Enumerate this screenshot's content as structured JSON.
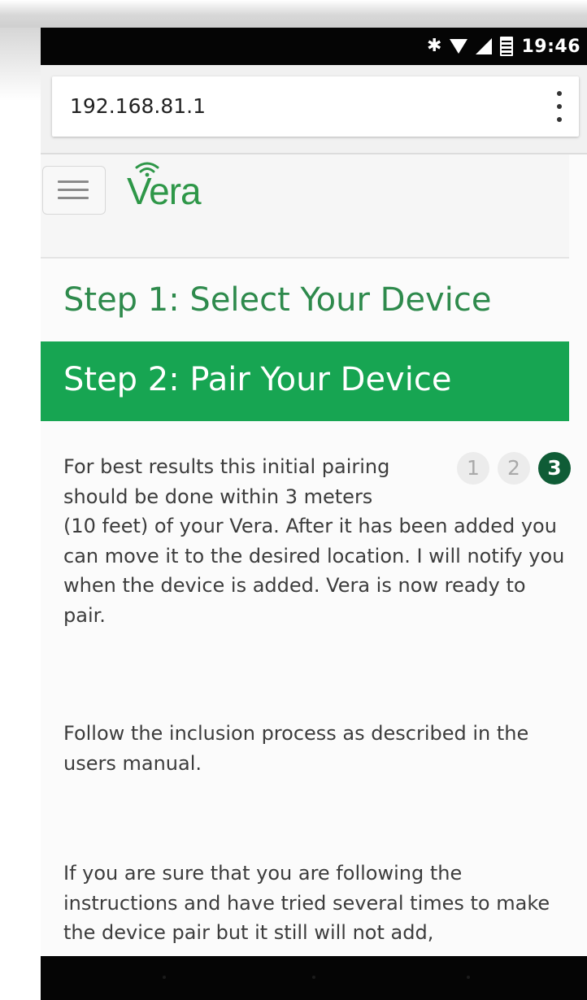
{
  "status_bar": {
    "time": "19:46",
    "icons": [
      "bluetooth-icon",
      "wifi-icon",
      "signal-icon",
      "battery-icon"
    ]
  },
  "browser": {
    "url": "192.168.81.1",
    "menu_icon": "more-vert-icon"
  },
  "header": {
    "logo_text": "Vera",
    "logo_color": "#2e9748",
    "menu_icon": "hamburger-icon"
  },
  "steps": {
    "step1_title": "Step 1: Select Your Device",
    "step2_title": "Step 2: Pair Your Device",
    "accent_color": "#17a552",
    "indicator": [
      {
        "label": "1",
        "active": false
      },
      {
        "label": "2",
        "active": false
      },
      {
        "label": "3",
        "active": true
      }
    ]
  },
  "content": {
    "para1": "For best results this initial pairing should be done within 3 meters (10 feet) of your Vera. After it has been added you can move it to the desired location. I will notify you when the device is added. Vera is now ready to pair.",
    "para2": "Follow the inclusion process as described in the users manual.",
    "para3": "If you are sure that you are following the instructions and have tried several times to make the device pair but it still will not add,"
  }
}
